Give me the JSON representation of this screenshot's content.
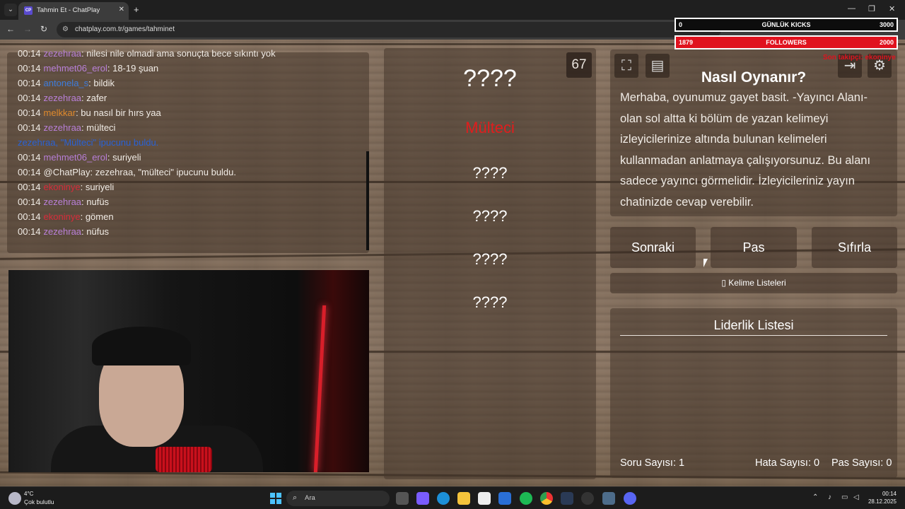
{
  "browser": {
    "tab_title": "Tahmin Et - ChatPlay",
    "favicon_text": "CP",
    "url": "chatplay.com.tr/games/tahminet"
  },
  "chat": {
    "lines": [
      {
        "time": "00:14",
        "user": "zezehraa",
        "user_color": "#b87fd8",
        "text": ": nilesi nile olmadi ama sonuçta bece sıkıntı yok"
      },
      {
        "time": "00:14",
        "user": "mehmet06_erol",
        "user_color": "#b87fd8",
        "text": ": 18-19 şuan"
      },
      {
        "time": "00:14",
        "user": "antonela_s",
        "user_color": "#3d7bd9",
        "text": ": bildik"
      },
      {
        "time": "00:14",
        "user": "zezehraa",
        "user_color": "#b87fd8",
        "text": ": zafer"
      },
      {
        "time": "00:14",
        "user": "melkkar",
        "user_color": "#e08a2c",
        "text": ": bu nasıl bir hırs yaa"
      },
      {
        "time": "00:14",
        "user": "zezehraa",
        "user_color": "#b87fd8",
        "text": ": mülteci"
      },
      {
        "time": "",
        "user": "zezehraa, \"Mülteci\" ipucunu buldu.",
        "user_color": "#2a62d6",
        "text": ""
      },
      {
        "time": "00:14",
        "user": "mehmet06_erol",
        "user_color": "#b87fd8",
        "text": ": suriyeli"
      },
      {
        "time": "00:14",
        "user": "",
        "user_color": "#f1ece6",
        "text": "@ChatPlay: zezehraa, \"mülteci\" ipucunu buldu."
      },
      {
        "time": "00:14",
        "user": "ekoninye",
        "user_color": "#d62b3a",
        "text": ": suriyeli"
      },
      {
        "time": "00:14",
        "user": "zezehraa",
        "user_color": "#b87fd8",
        "text": ": nufüs"
      },
      {
        "time": "00:14",
        "user": "ekoninye",
        "user_color": "#d62b3a",
        "text": ": gömen"
      },
      {
        "time": "00:14",
        "user": "zezehraa",
        "user_color": "#b87fd8",
        "text": ": nüfus"
      }
    ]
  },
  "game": {
    "timer": "67",
    "main_word": "????",
    "hint_found": "Mülteci",
    "hidden_words": [
      "????",
      "????",
      "????",
      "????"
    ]
  },
  "howto": {
    "title": "Nasıl Oynanır?",
    "text": "Merhaba, oyunumuz gayet basit. -Yayıncı Alanı- olan sol altta ki bölüm de yazan kelimeyi izleyicilerinize altında bulunan kelimeleri kullanmadan anlatmaya çalışıyorsunuz. Bu alanı sadece yayıncı görmelidir. İzleyicileriniz yayın chatinizde cevap verebilir."
  },
  "buttons": {
    "next": "Sonraki",
    "pass": "Pas",
    "reset": "Sıfırla",
    "word_lists": "Kelime Listeleri"
  },
  "leaderboard": {
    "title": "Liderlik Listesi",
    "question_count": "Soru Sayısı: 1",
    "error_count": "Hata Sayısı: 0",
    "pass_count": "Pas Sayısı: 0"
  },
  "overlay": {
    "kicks_current": "0",
    "kicks_label": "GÜNLÜK KICKS",
    "kicks_goal": "3000",
    "followers_current": "1879",
    "followers_label": "FOLLOWERS",
    "followers_goal": "2000",
    "followers_progress": 0.94,
    "red_text": "Son takipçi: ekoninye"
  },
  "taskbar": {
    "temperature": "4°C",
    "weather": "Çok bulutlu",
    "search_placeholder": "Ara",
    "time": "00:14",
    "date": "28.12.2025"
  }
}
